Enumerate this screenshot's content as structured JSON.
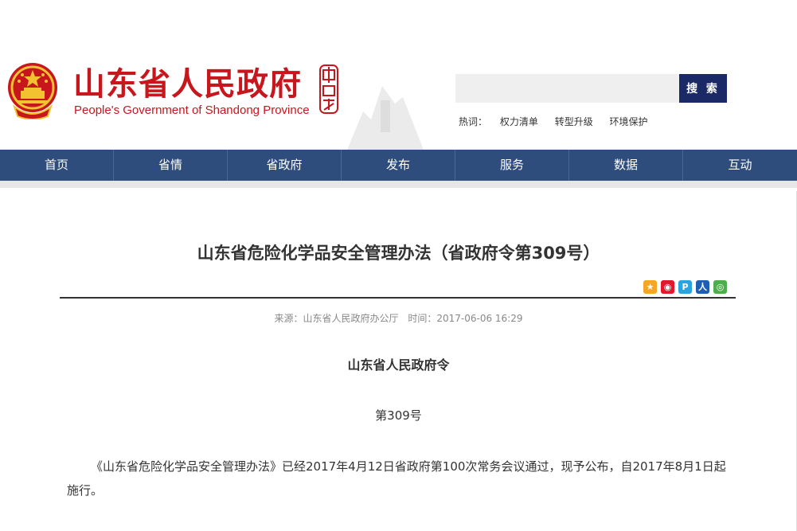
{
  "header": {
    "logo_cn": "山东省人民政府",
    "logo_en": "People's Government of Shandong Province",
    "search_placeholder": "",
    "search_button": "搜 索",
    "hotwords_label": "热词：",
    "hotwords": [
      "权力清单",
      "转型升级",
      "环境保护"
    ]
  },
  "nav": {
    "items": [
      "首页",
      "省情",
      "省政府",
      "发布",
      "服务",
      "数据",
      "互动"
    ]
  },
  "article": {
    "title": "山东省危险化学品安全管理办法（省政府令第309号）",
    "source": "来源：山东省人民政府办公厅",
    "time": "时间：2017-06-06 16:29",
    "decree": "山东省人民政府令",
    "number": "第309号",
    "paragraph": "《山东省危险化学品安全管理办法》已经2017年4月12日省政府第100次常务会议通过，现予公布，自2017年8月1日起施行。"
  },
  "share_icons": [
    "qzone-icon",
    "weibo-icon",
    "tencent-weibo-icon",
    "renren-icon",
    "wechat-icon"
  ],
  "colors": {
    "brand_red": "#c8161d",
    "nav_blue": "#2e4d7d",
    "search_button": "#1b2a67"
  }
}
